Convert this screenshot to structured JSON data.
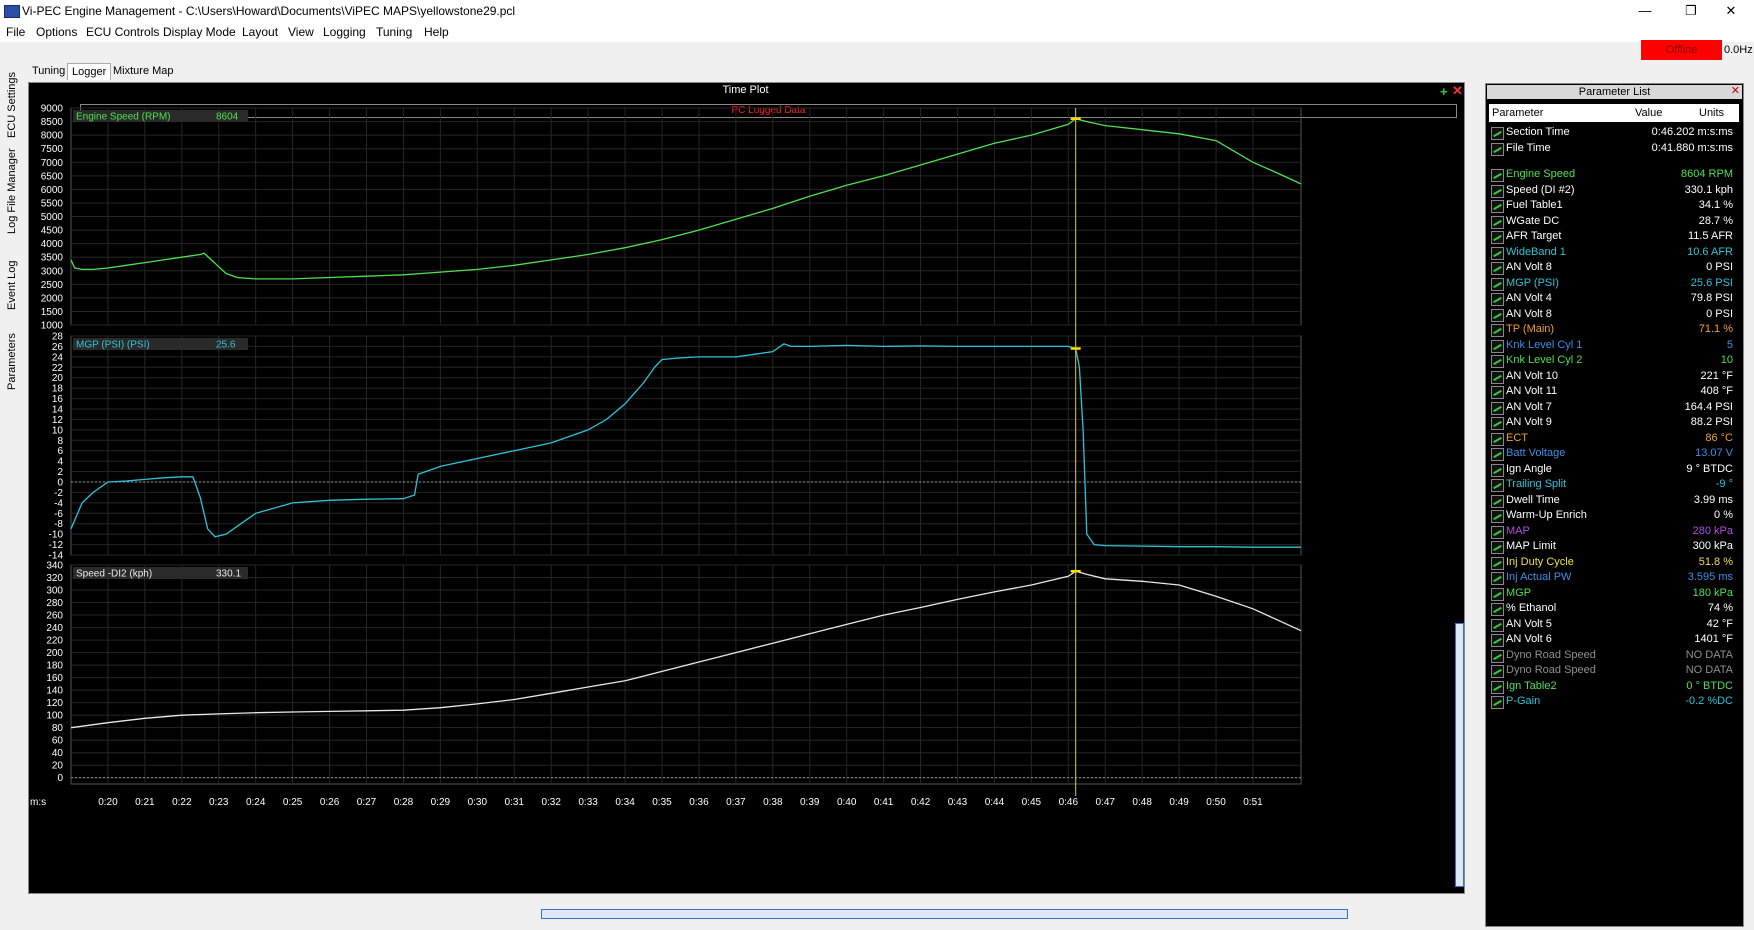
{
  "window": {
    "title": "Vi-PEC Engine Management - C:\\Users\\Howard\\Documents\\ViPEC MAPS\\yellowstone29.pcl",
    "controls": [
      "—",
      "❐",
      "✕"
    ]
  },
  "menu": [
    "File",
    "Options",
    "ECU Controls",
    "Display Mode",
    "Layout",
    "View",
    "Logging",
    "Tuning",
    "Help"
  ],
  "status": {
    "connection": "Offline",
    "rate": "0.0Hz"
  },
  "tabs": [
    "Tuning",
    "Logger",
    "Mixture Map"
  ],
  "side_tabs": [
    "ECU Settings",
    "Log File Manager",
    "Event Log",
    "Parameters"
  ],
  "plot": {
    "title": "Time Plot",
    "subtitle": "PC Logged Data",
    "xunit": "m:s",
    "xticks": [
      "0:20",
      "0:21",
      "0:22",
      "0:23",
      "0:24",
      "0:25",
      "0:26",
      "0:27",
      "0:28",
      "0:29",
      "0:30",
      "0:31",
      "0:32",
      "0:33",
      "0:34",
      "0:35",
      "0:36",
      "0:37",
      "0:38",
      "0:39",
      "0:40",
      "0:41",
      "0:42",
      "0:43",
      "0:44",
      "0:45",
      "0:46",
      "0:47",
      "0:48",
      "0:49",
      "0:50",
      "0:51"
    ],
    "cursor_time": "0:46.2"
  },
  "chart_data": [
    {
      "type": "line",
      "legend": "Engine Speed (RPM)",
      "cursor_value": "8604",
      "color": "#4fe04f",
      "ylim": [
        1000,
        9000
      ],
      "yticks": [
        1000,
        1500,
        2000,
        2500,
        3000,
        3500,
        4000,
        4500,
        5000,
        5500,
        6000,
        6500,
        7000,
        7500,
        8000,
        8500,
        9000
      ],
      "x": [
        19.0,
        19.1,
        19.3,
        19.6,
        20.0,
        20.5,
        21.0,
        21.5,
        22.0,
        22.5,
        22.6,
        22.8,
        23.0,
        23.2,
        23.5,
        24,
        25,
        26,
        27,
        28,
        29,
        30,
        31,
        32,
        33,
        34,
        35,
        36,
        37,
        38,
        39,
        40,
        41,
        42,
        43,
        44,
        45,
        46,
        46.2,
        46.5,
        47,
        48,
        49,
        50,
        50.5,
        51,
        51.5,
        52.3
      ],
      "y": [
        3400,
        3100,
        3050,
        3050,
        3100,
        3200,
        3300,
        3400,
        3500,
        3600,
        3650,
        3400,
        3150,
        2900,
        2750,
        2700,
        2700,
        2750,
        2800,
        2850,
        2950,
        3050,
        3200,
        3400,
        3600,
        3850,
        4150,
        4500,
        4900,
        5300,
        5750,
        6150,
        6500,
        6900,
        7300,
        7700,
        8000,
        8400,
        8604,
        8500,
        8350,
        8200,
        8050,
        7800,
        7400,
        7000,
        6700,
        6200
      ]
    },
    {
      "type": "line",
      "legend": "MGP (PSI) (PSI)",
      "cursor_value": "25.6",
      "color": "#2ec4d8",
      "ylim": [
        -14,
        28
      ],
      "yticks": [
        -14,
        -12,
        -10,
        -8,
        -6,
        -4,
        -2,
        0,
        2,
        4,
        6,
        8,
        10,
        12,
        14,
        16,
        18,
        20,
        22,
        24,
        26,
        28
      ],
      "x": [
        19.0,
        19.3,
        19.6,
        20.0,
        20.5,
        21,
        21.5,
        22,
        22.3,
        22.5,
        22.7,
        22.9,
        23.2,
        23.6,
        24,
        24.5,
        25,
        26,
        27,
        28,
        28.3,
        28.4,
        29,
        30,
        31,
        32,
        33,
        33.5,
        34,
        34.5,
        34.8,
        35,
        35.5,
        36,
        37,
        37.5,
        38,
        38.3,
        38.5,
        39,
        40,
        41,
        42,
        43,
        44,
        45,
        46,
        46.2,
        46.3,
        46.4,
        46.5,
        46.7,
        47,
        48,
        49,
        50,
        51,
        52.3
      ],
      "y": [
        -9,
        -4,
        -2,
        0,
        0.2,
        0.5,
        0.8,
        1.0,
        1.0,
        -3,
        -9,
        -10.5,
        -10,
        -8,
        -6,
        -5,
        -4,
        -3.5,
        -3.3,
        -3.2,
        -2.5,
        1.5,
        3,
        4.5,
        6,
        7.5,
        10,
        12,
        15,
        19,
        22,
        23.5,
        23.8,
        24,
        24,
        24.5,
        25,
        26.5,
        26,
        26,
        26.2,
        26,
        26.1,
        26,
        26,
        26,
        26,
        25.6,
        22,
        10,
        -10,
        -12,
        -12.2,
        -12.3,
        -12.4,
        -12.4,
        -12.5,
        -12.5
      ]
    },
    {
      "type": "line",
      "legend": "Speed -DI2 (kph)",
      "cursor_value": "330.1",
      "color": "#e8e8e8",
      "ylim": [
        -10,
        340
      ],
      "yticks": [
        0,
        20,
        40,
        60,
        80,
        100,
        120,
        140,
        160,
        180,
        200,
        220,
        240,
        260,
        280,
        300,
        320,
        340
      ],
      "x": [
        19,
        20,
        21,
        22,
        23,
        24,
        25,
        26,
        27,
        28,
        29,
        30,
        31,
        32,
        33,
        34,
        35,
        36,
        37,
        38,
        39,
        40,
        41,
        42,
        43,
        44,
        45,
        46,
        46.2,
        46.5,
        47,
        48,
        49,
        50,
        51,
        52.3
      ],
      "y": [
        80,
        88,
        95,
        100,
        102,
        104,
        105,
        106,
        107,
        108,
        112,
        118,
        125,
        135,
        145,
        155,
        170,
        185,
        200,
        215,
        230,
        245,
        260,
        272,
        285,
        297,
        308,
        322,
        330.1,
        325,
        318,
        314,
        308,
        290,
        270,
        235
      ]
    }
  ],
  "param_list": {
    "title": "Parameter List",
    "columns": [
      "Parameter",
      "Value",
      "Units"
    ],
    "top": [
      {
        "name": "Section Time",
        "value": "0:46.202 m:s:ms",
        "color": "#ffffff"
      },
      {
        "name": "File Time",
        "value": "0:41.880 m:s:ms",
        "color": "#ffffff"
      }
    ],
    "rows": [
      {
        "name": "Engine Speed",
        "value": "8604 RPM",
        "color": "#4fe04f"
      },
      {
        "name": "Speed (DI #2)",
        "value": "330.1 kph",
        "color": "#ffffff"
      },
      {
        "name": "Fuel Table1",
        "value": "34.1 %",
        "color": "#ffffff"
      },
      {
        "name": "WGate DC",
        "value": "28.7 %",
        "color": "#ffffff"
      },
      {
        "name": "AFR Target",
        "value": "11.5 AFR",
        "color": "#ffffff"
      },
      {
        "name": "WideBand 1",
        "value": "10.6 AFR",
        "color": "#2ec4d8"
      },
      {
        "name": "AN Volt 8",
        "value": "0 PSI",
        "color": "#ffffff"
      },
      {
        "name": "MGP (PSI)",
        "value": "25.6 PSI",
        "color": "#2ec4d8"
      },
      {
        "name": "AN Volt 4",
        "value": "79.8 PSI",
        "color": "#ffffff"
      },
      {
        "name": "AN Volt 8",
        "value": "0 PSI",
        "color": "#ffffff"
      },
      {
        "name": "TP (Main)",
        "value": "71.1 %",
        "color": "#f0a030"
      },
      {
        "name": "Knk Level Cyl 1",
        "value": "5",
        "color": "#3a8fe8"
      },
      {
        "name": "Knk Level Cyl 2",
        "value": "10",
        "color": "#4fe04f"
      },
      {
        "name": "AN Volt 10",
        "value": "221 °F",
        "color": "#ffffff"
      },
      {
        "name": "AN Volt 11",
        "value": "408 °F",
        "color": "#ffffff"
      },
      {
        "name": "AN Volt 7",
        "value": "164.4 PSI",
        "color": "#ffffff"
      },
      {
        "name": "AN Volt 9",
        "value": "88.2 PSI",
        "color": "#ffffff"
      },
      {
        "name": "ECT",
        "value": "86 °C",
        "color": "#f0a030"
      },
      {
        "name": "Batt Voltage",
        "value": "13.07 V",
        "color": "#3a8fe8"
      },
      {
        "name": "Ign Angle",
        "value": "9 ° BTDC",
        "color": "#ffffff"
      },
      {
        "name": "Trailing Split",
        "value": "-9 °",
        "color": "#2ec4d8"
      },
      {
        "name": "Dwell Time",
        "value": "3.99 ms",
        "color": "#ffffff"
      },
      {
        "name": "Warm-Up Enrich",
        "value": "0 %",
        "color": "#ffffff"
      },
      {
        "name": "MAP",
        "value": "280 kPa",
        "color": "#b050e0"
      },
      {
        "name": "MAP Limit",
        "value": "300 kPa",
        "color": "#ffffff"
      },
      {
        "name": "Inj Duty Cycle",
        "value": "51.8 %",
        "color": "#f0e040"
      },
      {
        "name": "Inj Actual PW",
        "value": "3.595 ms",
        "color": "#3a8fe8"
      },
      {
        "name": "MGP",
        "value": "180 kPa",
        "color": "#4fe04f"
      },
      {
        "name": "% Ethanol",
        "value": "74 %",
        "color": "#ffffff"
      },
      {
        "name": "AN Volt 5",
        "value": "42 °F",
        "color": "#ffffff"
      },
      {
        "name": "AN Volt 6",
        "value": "1401 °F",
        "color": "#ffffff"
      },
      {
        "name": "Dyno Road Speed",
        "value": "NO DATA",
        "color": "#909090"
      },
      {
        "name": "Dyno Road Speed",
        "value": "NO DATA",
        "color": "#909090"
      },
      {
        "name": "Ign Table2",
        "value": "0 ° BTDC",
        "color": "#4fe04f"
      },
      {
        "name": "P-Gain",
        "value": "-0.2 %DC",
        "color": "#2ec4d8"
      }
    ]
  }
}
